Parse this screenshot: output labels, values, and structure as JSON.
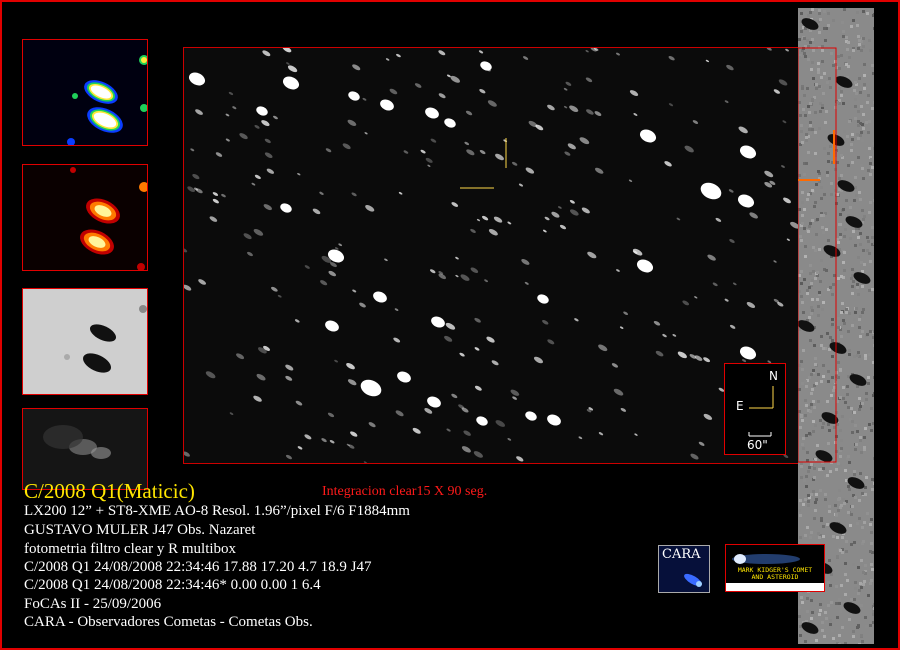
{
  "title": "C/2008 Q1(Maticic)",
  "subtitle": "Integracion clear15 X 90 seg.",
  "info_lines": [
    "LX200 12” +  ST8-XME AO-8  Resol. 1.96”/pixel  F/6  F1884mm",
    "GUSTAVO MULER  J47 Obs. Nazaret",
    "fotometria filtro clear y R multibox",
    "C/2008 Q1 24/08/2008 22:34:46 17.88 17.20 4.7 18.9 J47",
    "C/2008 Q1 24/08/2008 22:34:46* 0.00 0.00 1 6.4",
    "FoCAs II - 25/09/2006",
    "CARA -  Observadores Cometas  -  Cometas Obs."
  ],
  "compass": {
    "north": "N",
    "east": "E",
    "scale": "60\""
  },
  "logos": {
    "cara": "CARA",
    "kidger": "MARK KIDGER'S COMET AND ASTEROID"
  },
  "colors": {
    "frame": "#e00000",
    "title": "#ffe600",
    "subtitle": "#ff1a1a",
    "marker": "#ffd84a"
  }
}
